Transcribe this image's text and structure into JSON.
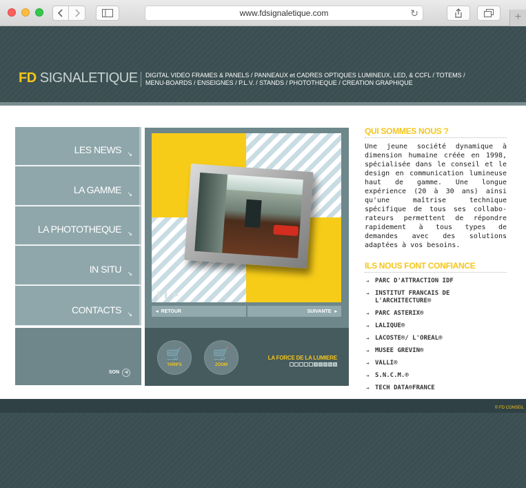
{
  "browser": {
    "url": "www.fdsignaletique.com"
  },
  "header": {
    "logo_fd": "FD",
    "logo_name": "SIGNALETIQUE",
    "nav": [
      "DIGITAL VIDEO  FRAMES & PANELS",
      "/  PANNEAUX et CADRES OPTIQUES LUMINEUX, LED, & CCFL",
      "/  TOTEMS  /",
      "MENU-BOARDS",
      "/  ENSEIGNES",
      "/  P.L.V.",
      "/  STANDS",
      "/ PHOTOTHEQUE",
      "/  CREATION GRAPHIQUE"
    ]
  },
  "menu": {
    "items": [
      {
        "label": "LES NEWS"
      },
      {
        "label": "LA GAMME"
      },
      {
        "label": "LA PHOTOTHEQUE"
      },
      {
        "label": "IN SITU"
      },
      {
        "label": "CONTACTS"
      }
    ],
    "son_label": "SON"
  },
  "viewer": {
    "retour": "RETOUR",
    "suivante": "SUIVANTE",
    "tarifs": "TARIFS",
    "zoom": "ZOOM",
    "slogan": "LA FORCE DE LA LUMIERE",
    "slide_count": 10,
    "active_slides": [
      5,
      6,
      7,
      8,
      9
    ]
  },
  "about": {
    "title": "QUI SOMMES  NOUS ?",
    "text": "Une jeune société dynamique à dimension humaine créée en 1998, spécialisée dans le conseil et le design en communication lumineuse haut de gamme. Une longue expérience (20 à 30 ans) ainsi qu'une maîtrise technique spécifique de tous ses collabo-rateurs permettent de répondre rapidement à tous types de demandes avec des solutions adaptées à vos besoins."
  },
  "clients": {
    "title": "ILS NOUS FONT CONFIANCE",
    "items": [
      "PARC D'ATTRACTION IDF",
      "INSTITUT FRANCAIS DE L'ARCHITECTURE®",
      "PARC ASTERIX®",
      "LALIQUE®",
      "LACOSTE®/ L'OREAL®",
      "MUSEE GREVIN®",
      "VALLI®",
      "S.N.C.M.®",
      "TECH DATA®FRANCE"
    ]
  },
  "footer": {
    "copyright": "© FD CONSEIL"
  },
  "colors": {
    "accent": "#f5c518",
    "menu": "#8fa7ab",
    "header_bg": "#3b4f52"
  }
}
